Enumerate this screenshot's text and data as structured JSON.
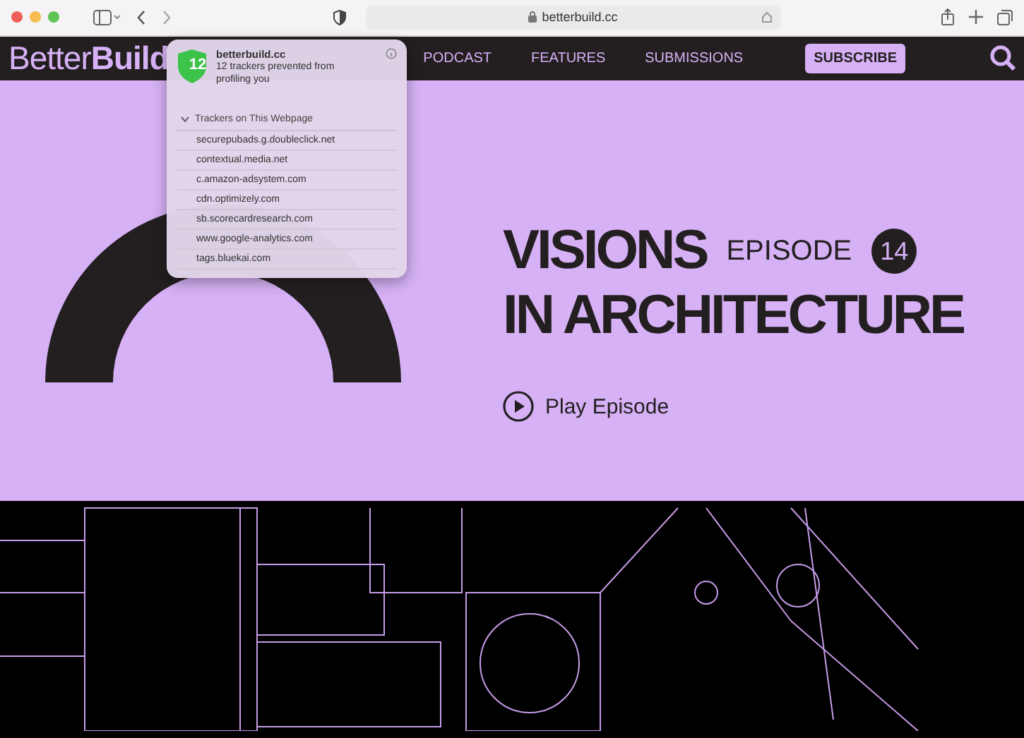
{
  "browser": {
    "url": "betterbuild.cc"
  },
  "site": {
    "logo_light": "Better",
    "logo_bold": "Build",
    "nav": [
      {
        "label": "PODCAST"
      },
      {
        "label": "FEATURES"
      },
      {
        "label": "SUBMISSIONS"
      }
    ],
    "subscribe": "SUBSCRIBE"
  },
  "privacy_popover": {
    "count": "12",
    "site": "betterbuild.cc",
    "summary": "12 trackers prevented from profiling you",
    "section": "Trackers on This Webpage",
    "expanded": true,
    "trackers": [
      "securepubads.g.doubleclick.net",
      "contextual.media.net",
      "c.amazon-adsystem.com",
      "cdn.optimizely.com",
      "sb.scorecardresearch.com",
      "www.google-analytics.com",
      "tags.bluekai.com"
    ]
  },
  "hero": {
    "title_line_1": "VISIONS",
    "episode_label": "EPISODE",
    "episode_number": "14",
    "title_line_2": "IN ARCHITECTURE",
    "play": "Play Episode"
  }
}
